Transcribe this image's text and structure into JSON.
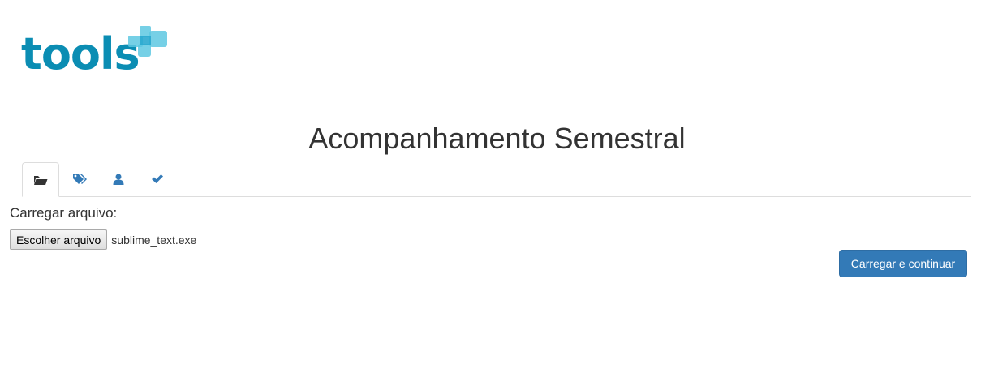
{
  "logo": {
    "text": "tools",
    "color": "#0b8db3",
    "mark_color": "#4cc3e0"
  },
  "page_title": "Acompanhamento Semestral",
  "tabs": [
    {
      "icon": "folder-open-icon",
      "active": true
    },
    {
      "icon": "tags-icon",
      "active": false
    },
    {
      "icon": "user-icon",
      "active": false
    },
    {
      "icon": "checkmark-icon",
      "active": false
    }
  ],
  "upload": {
    "label": "Carregar arquivo:",
    "choose_button": "Escolher arquivo",
    "file_name": "sublime_text.exe"
  },
  "submit_button": "Carregar e continuar",
  "colors": {
    "primary": "#337ab7",
    "icon_blue": "#337ab7",
    "text": "#333333"
  }
}
